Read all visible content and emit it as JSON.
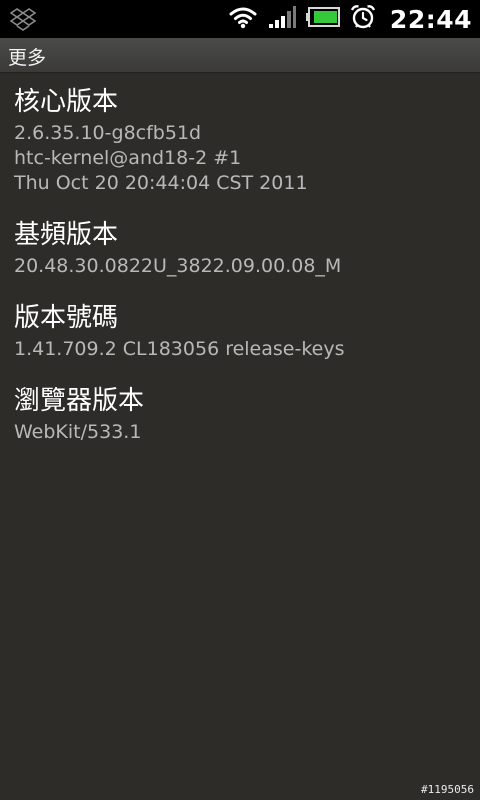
{
  "status_bar": {
    "time": "22:44",
    "icons": [
      "dropbox-icon",
      "wifi-icon",
      "signal-icon",
      "battery-icon",
      "alarm-icon"
    ],
    "battery_color": "#35c83a"
  },
  "title_bar": {
    "title": "更多"
  },
  "items": [
    {
      "title": "核心版本",
      "lines": [
        "2.6.35.10-g8cfb51d",
        "htc-kernel@and18-2 #1",
        "Thu Oct 20 20:44:04 CST 2011"
      ]
    },
    {
      "title": "基頻版本",
      "lines": [
        "20.48.30.0822U_3822.09.00.08_M"
      ]
    },
    {
      "title": "版本號碼",
      "lines": [
        "1.41.709.2 CL183056 release-keys"
      ]
    },
    {
      "title": "瀏覽器版本",
      "lines": [
        "WebKit/533.1"
      ]
    }
  ],
  "watermark": "#1195056"
}
